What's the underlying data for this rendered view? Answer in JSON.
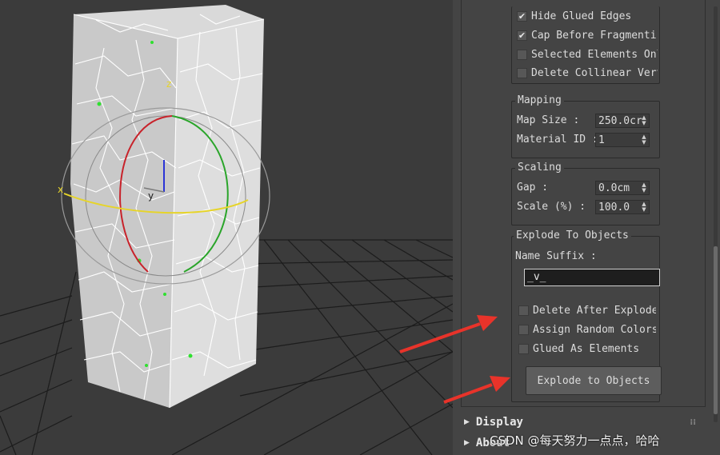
{
  "viewport": {
    "gizmo_axes": {
      "z": "z",
      "y": "y",
      "x": "x"
    }
  },
  "panel": {
    "options": [
      {
        "label": "Hide Glued Edges",
        "checked": true
      },
      {
        "label": "Cap Before Fragmentir",
        "checked": true
      },
      {
        "label": "Selected Elements Onl",
        "checked": false
      },
      {
        "label": "Delete Collinear Vert",
        "checked": false
      }
    ],
    "mapping": {
      "title": "Mapping",
      "map_size_label": "Map Size :",
      "map_size_value": "250.0cr",
      "material_id_label": "Material ID :",
      "material_id_value": "1"
    },
    "scaling": {
      "title": "Scaling",
      "gap_label": "Gap :",
      "gap_value": "0.0cm",
      "scale_label": "Scale (%) :",
      "scale_value": "100.0"
    },
    "explode": {
      "title": "Explode To Objects",
      "name_suffix_label": "Name Suffix :",
      "name_suffix_value": "_v_",
      "delete_after": {
        "label": "Delete After Explode",
        "checked": false
      },
      "assign_colors": {
        "label": "Assign Random Colors",
        "checked": false
      },
      "glued": {
        "label": "Glued As Elements",
        "checked": false
      },
      "button_label": "Explode to Objects"
    },
    "rollouts": [
      {
        "label": "Display"
      },
      {
        "label": "About"
      }
    ]
  },
  "watermark": "CSDN @每天努力一点点，哈哈",
  "colors": {
    "annotation_arrow": "#e8332a",
    "mesh_edge": "#ffffff",
    "gizmo_red": "#c8222a",
    "gizmo_green": "#2aa52a",
    "gizmo_yellow": "#e6d42a"
  }
}
